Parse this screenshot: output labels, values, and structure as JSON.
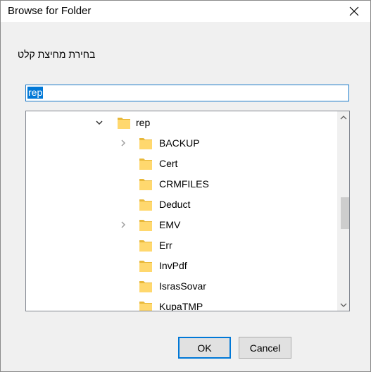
{
  "window": {
    "title": "Browse for Folder"
  },
  "dialog": {
    "prompt": "בחירת מחיצת קלט"
  },
  "folder_field": {
    "value": "rep"
  },
  "tree": {
    "parent": {
      "label": "rep",
      "expanded": true
    },
    "children": [
      {
        "label": "BACKUP",
        "has_children": true
      },
      {
        "label": "Cert",
        "has_children": false
      },
      {
        "label": "CRMFILES",
        "has_children": false
      },
      {
        "label": "Deduct",
        "has_children": false
      },
      {
        "label": "EMV",
        "has_children": true
      },
      {
        "label": "Err",
        "has_children": false
      },
      {
        "label": "InvPdf",
        "has_children": false
      },
      {
        "label": "IsrasSovar",
        "has_children": false
      },
      {
        "label": "KupaTMP",
        "has_children": false
      }
    ],
    "scroll_position": 0.45
  },
  "buttons": {
    "ok": "OK",
    "cancel": "Cancel"
  },
  "colors": {
    "accent": "#0078d7",
    "folder": "#ffd86e",
    "folder_dark": "#e8b83a"
  },
  "icons": {
    "close": "close-icon",
    "expanded": "chevron-down-icon",
    "collapsed": "chevron-right-icon",
    "folder": "folder-icon",
    "scroll_up": "chevron-up-icon",
    "scroll_down": "chevron-down-icon"
  }
}
